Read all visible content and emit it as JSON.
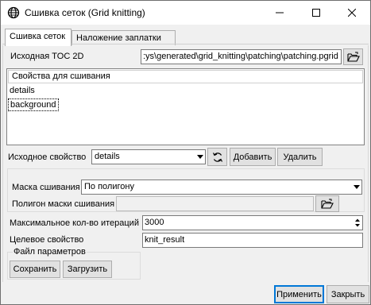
{
  "window": {
    "title": "Сшивка сеток (Grid knitting)",
    "icon": "globe-icon",
    "controls": [
      "minimize-icon",
      "maximize-icon",
      "close-icon"
    ]
  },
  "tabs": [
    {
      "label": "Сшивка сеток",
      "active": true
    },
    {
      "label": "Наложение заплатки",
      "active": false
    }
  ],
  "source_toc": {
    "label": "Исходная TOC 2D",
    "value": ":ys\\generated\\grid_knitting\\patching\\patching.pgrid",
    "browse_icon": "folder-open-icon"
  },
  "properties_list": {
    "header": "Свойства для сшивания",
    "items": [
      "details",
      "background"
    ],
    "focused_item": "background"
  },
  "source_property": {
    "label": "Исходное свойство",
    "value": "details",
    "refresh_icon": "refresh-icon",
    "add_label": "Добавить",
    "remove_label": "Удалить"
  },
  "mask": {
    "label": "Маска сшивания",
    "value": "По полигону",
    "polygon_label": "Полигон маски сшивания",
    "polygon_value": "",
    "browse_icon": "folder-open-icon"
  },
  "iterations": {
    "label": "Максимальное кол-во итераций",
    "value": "3000"
  },
  "target": {
    "label": "Целевое свойство",
    "value": "knit_result"
  },
  "params_file": {
    "label": "Файл параметров",
    "save_label": "Сохранить",
    "load_label": "Загрузить"
  },
  "footer": {
    "apply_label": "Применить",
    "close_label": "Закрыть"
  }
}
